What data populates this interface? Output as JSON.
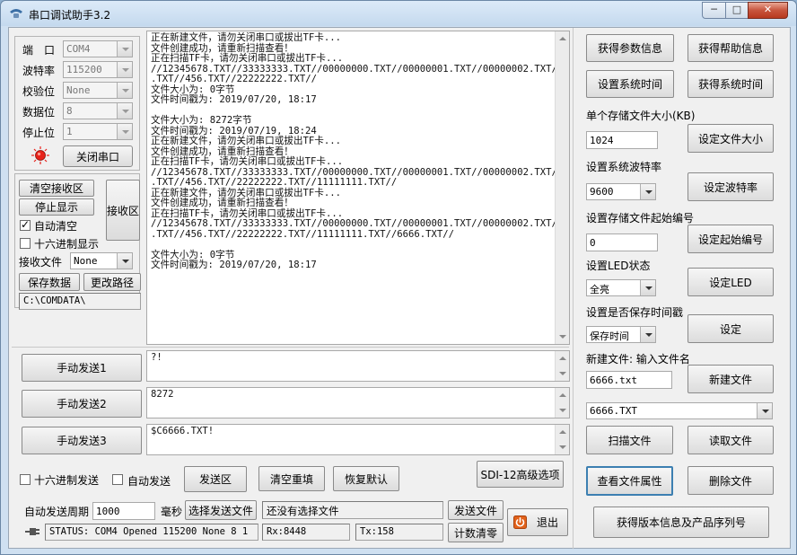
{
  "window": {
    "title": "串口调试助手3.2",
    "min": "─",
    "max": "□",
    "close": "✕"
  },
  "serial": {
    "port_label": "端　口",
    "port_value": "COM4",
    "baud_label": "波特率",
    "baud_value": "115200",
    "parity_label": "校验位",
    "parity_value": "None",
    "data_label": "数据位",
    "data_value": "8",
    "stop_label": "停止位",
    "stop_value": "1",
    "close_button": "关闭串口"
  },
  "receive": {
    "clear_button": "清空接收区",
    "stop_button": "停止显示",
    "area_button": "接收区",
    "auto_clear_label": "自动清空",
    "hex_display_label": "十六进制显示",
    "file_label": "接收文件",
    "file_value": "None",
    "save_button": "保存数据",
    "path_button": "更改路径",
    "path_value": "C:\\COMDATA\\"
  },
  "log": "正在新建文件，请勿关闭串口或拔出TF卡...\n文件创建成功，请重新扫描查看！\n正在扫描TF卡，请勿关闭串口或拔出TF卡...\n//12345678.TXT//33333333.TXT//00000000.TXT//00000001.TXT//00000002.TXT//123\n.TXT//456.TXT//22222222.TXT//\n文件大小为: 0字节\n文件时间戳为: 2019/07/20, 18:17\n\n文件大小为: 8272字节\n文件时间戳为: 2019/07/19, 18:24\n正在新建文件，请勿关闭串口或拔出TF卡...\n文件创建成功，请重新扫描查看！\n正在扫描TF卡，请勿关闭串口或拔出TF卡...\n//12345678.TXT//33333333.TXT//00000000.TXT//00000001.TXT//00000002.TXT//123\n.TXT//456.TXT//22222222.TXT//11111111.TXT//\n正在新建文件，请勿关闭串口或拔出TF卡...\n文件创建成功，请重新扫描查看！\n正在扫描TF卡，请勿关闭串口或拔出TF卡...\n//12345678.TXT//33333333.TXT//00000000.TXT//00000001.TXT//00000002.TXT//123\n.TXT//456.TXT//22222222.TXT//11111111.TXT//6666.TXT//\n\n文件大小为: 0字节\n文件时间戳为: 2019/07/20, 18:17",
  "send": {
    "send1_button": "手动发送1",
    "send1_value": "?!",
    "send2_button": "手动发送2",
    "send2_value": "8272",
    "send3_button": "手动发送3",
    "send3_value": "$C6666.TXT!",
    "hex_send_label": "十六进制发送",
    "auto_send_label": "自动发送",
    "area_button": "发送区",
    "clear_count_button": "清空重填",
    "restore_button": "恢复默认",
    "sdi_button": "SDI-12高级选项",
    "period_label": "自动发送周期",
    "period_value": "1000",
    "ms_label": "毫秒",
    "choose_file_button": "选择发送文件",
    "no_file_text": "还没有选择文件",
    "send_file_button": "发送文件",
    "count_clear_button": "计数清零",
    "exit_button": "退出"
  },
  "statusbar": {
    "status": "STATUS: COM4 Opened 115200 None 8 1",
    "rx": "Rx:8448",
    "tx": "Tx:158"
  },
  "right": {
    "get_params_button": "获得参数信息",
    "get_help_button": "获得帮助信息",
    "set_time_button": "设置系统时间",
    "get_time_button": "获得系统时间",
    "file_size_label": "单个存储文件大小(KB)",
    "file_size_value": "1024",
    "set_file_size_button": "设定文件大小",
    "baud_label": "设置系统波特率",
    "baud_value": "9600",
    "set_baud_button": "设定波特率",
    "start_num_label": "设置存储文件起始编号",
    "start_num_value": "0",
    "set_start_num_button": "设定起始编号",
    "led_label": "设置LED状态",
    "led_value": "全亮",
    "set_led_button": "设定LED",
    "timestamp_label": "设置是否保存时间戳",
    "timestamp_value": "保存时间",
    "set_timestamp_button": "设定",
    "new_file_label": "新建文件: 输入文件名",
    "new_file_value": "6666.txt",
    "new_file_button": "新建文件",
    "file_select_value": "6666.TXT",
    "scan_button": "扫描文件",
    "read_button": "读取文件",
    "attr_button": "查看文件属性",
    "delete_button": "删除文件",
    "version_button": "获得版本信息及产品序列号"
  },
  "colors": {
    "led_red": "#e8221a",
    "exit_icon_orange": "#e2621b"
  }
}
